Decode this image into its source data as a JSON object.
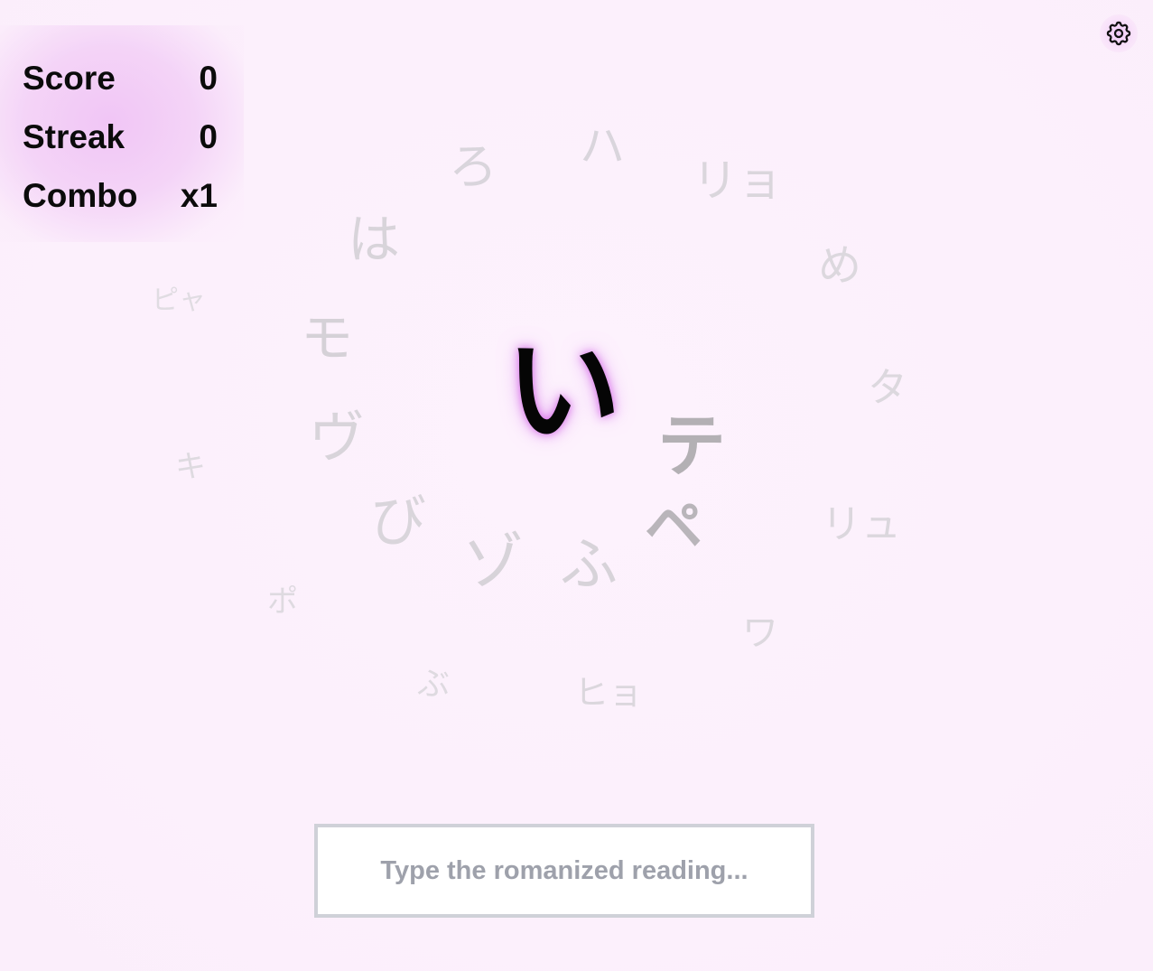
{
  "stats": {
    "score_label": "Score",
    "score_value": "0",
    "streak_label": "Streak",
    "streak_value": "0",
    "combo_label": "Combo",
    "combo_value": "x1"
  },
  "settings": {
    "icon": "gear-icon"
  },
  "current_character": "い",
  "floating_characters": [
    "ろ",
    "ハ",
    "リョ",
    "は",
    "め",
    "ピャ",
    "モ",
    "タ",
    "ヴ",
    "テ",
    "キ",
    "び",
    "ペ",
    "リュ",
    "ゾ",
    "ふ",
    "ポ",
    "ワ",
    "ぶ",
    "ヒョ"
  ],
  "answer_input": {
    "placeholder": "Type the romanized reading...",
    "value": ""
  },
  "colors": {
    "background": "#fcf0fc",
    "stats_glow": "#f0c3f5",
    "main_char": "#050505",
    "main_char_glow": "#d25ae6",
    "floating_light": "#d7d3d9",
    "floating_dark": "#b4b1b5",
    "input_border": "#cfd1d8",
    "placeholder": "#9ea1ab"
  }
}
